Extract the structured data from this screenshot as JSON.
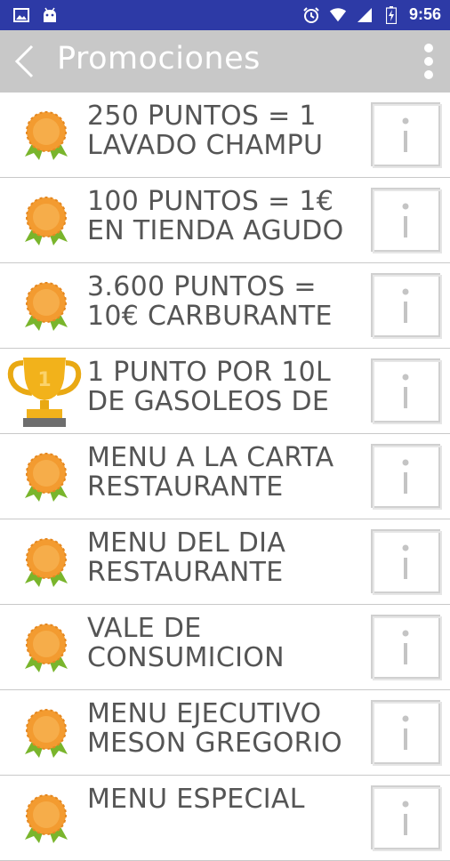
{
  "status_bar": {
    "time": "9:56",
    "left_icons": [
      "image-icon",
      "android-icon"
    ],
    "right_icons": [
      "alarm-icon",
      "wifi-icon",
      "signal-icon",
      "battery-icon"
    ],
    "color": "#2d3aa6"
  },
  "app_bar": {
    "title": "Promociones",
    "background": "#c8c8c8"
  },
  "promotions": [
    {
      "text": "250 PUNTOS = 1\nLAVADO CHAMPU",
      "icon": "medal-icon"
    },
    {
      "text": "100 PUNTOS = 1€\nEN TIENDA AGUDO",
      "icon": "medal-icon"
    },
    {
      "text": "3.600 PUNTOS =\n10€ CARBURANTE",
      "icon": "medal-icon"
    },
    {
      "text": "1 PUNTO POR 10L\nDE GASOLEOS DE",
      "icon": "trophy-icon",
      "trophy_number": "1"
    },
    {
      "text": "MENU A LA CARTA\nRESTAURANTE",
      "icon": "medal-icon"
    },
    {
      "text": "MENU DEL DIA\nRESTAURANTE",
      "icon": "medal-icon"
    },
    {
      "text": "VALE DE\nCONSUMICION",
      "icon": "medal-icon"
    },
    {
      "text": "MENU EJECUTIVO\nMESON GREGORIO",
      "icon": "medal-icon"
    },
    {
      "text": "MENU ESPECIAL",
      "icon": "medal-icon"
    }
  ]
}
